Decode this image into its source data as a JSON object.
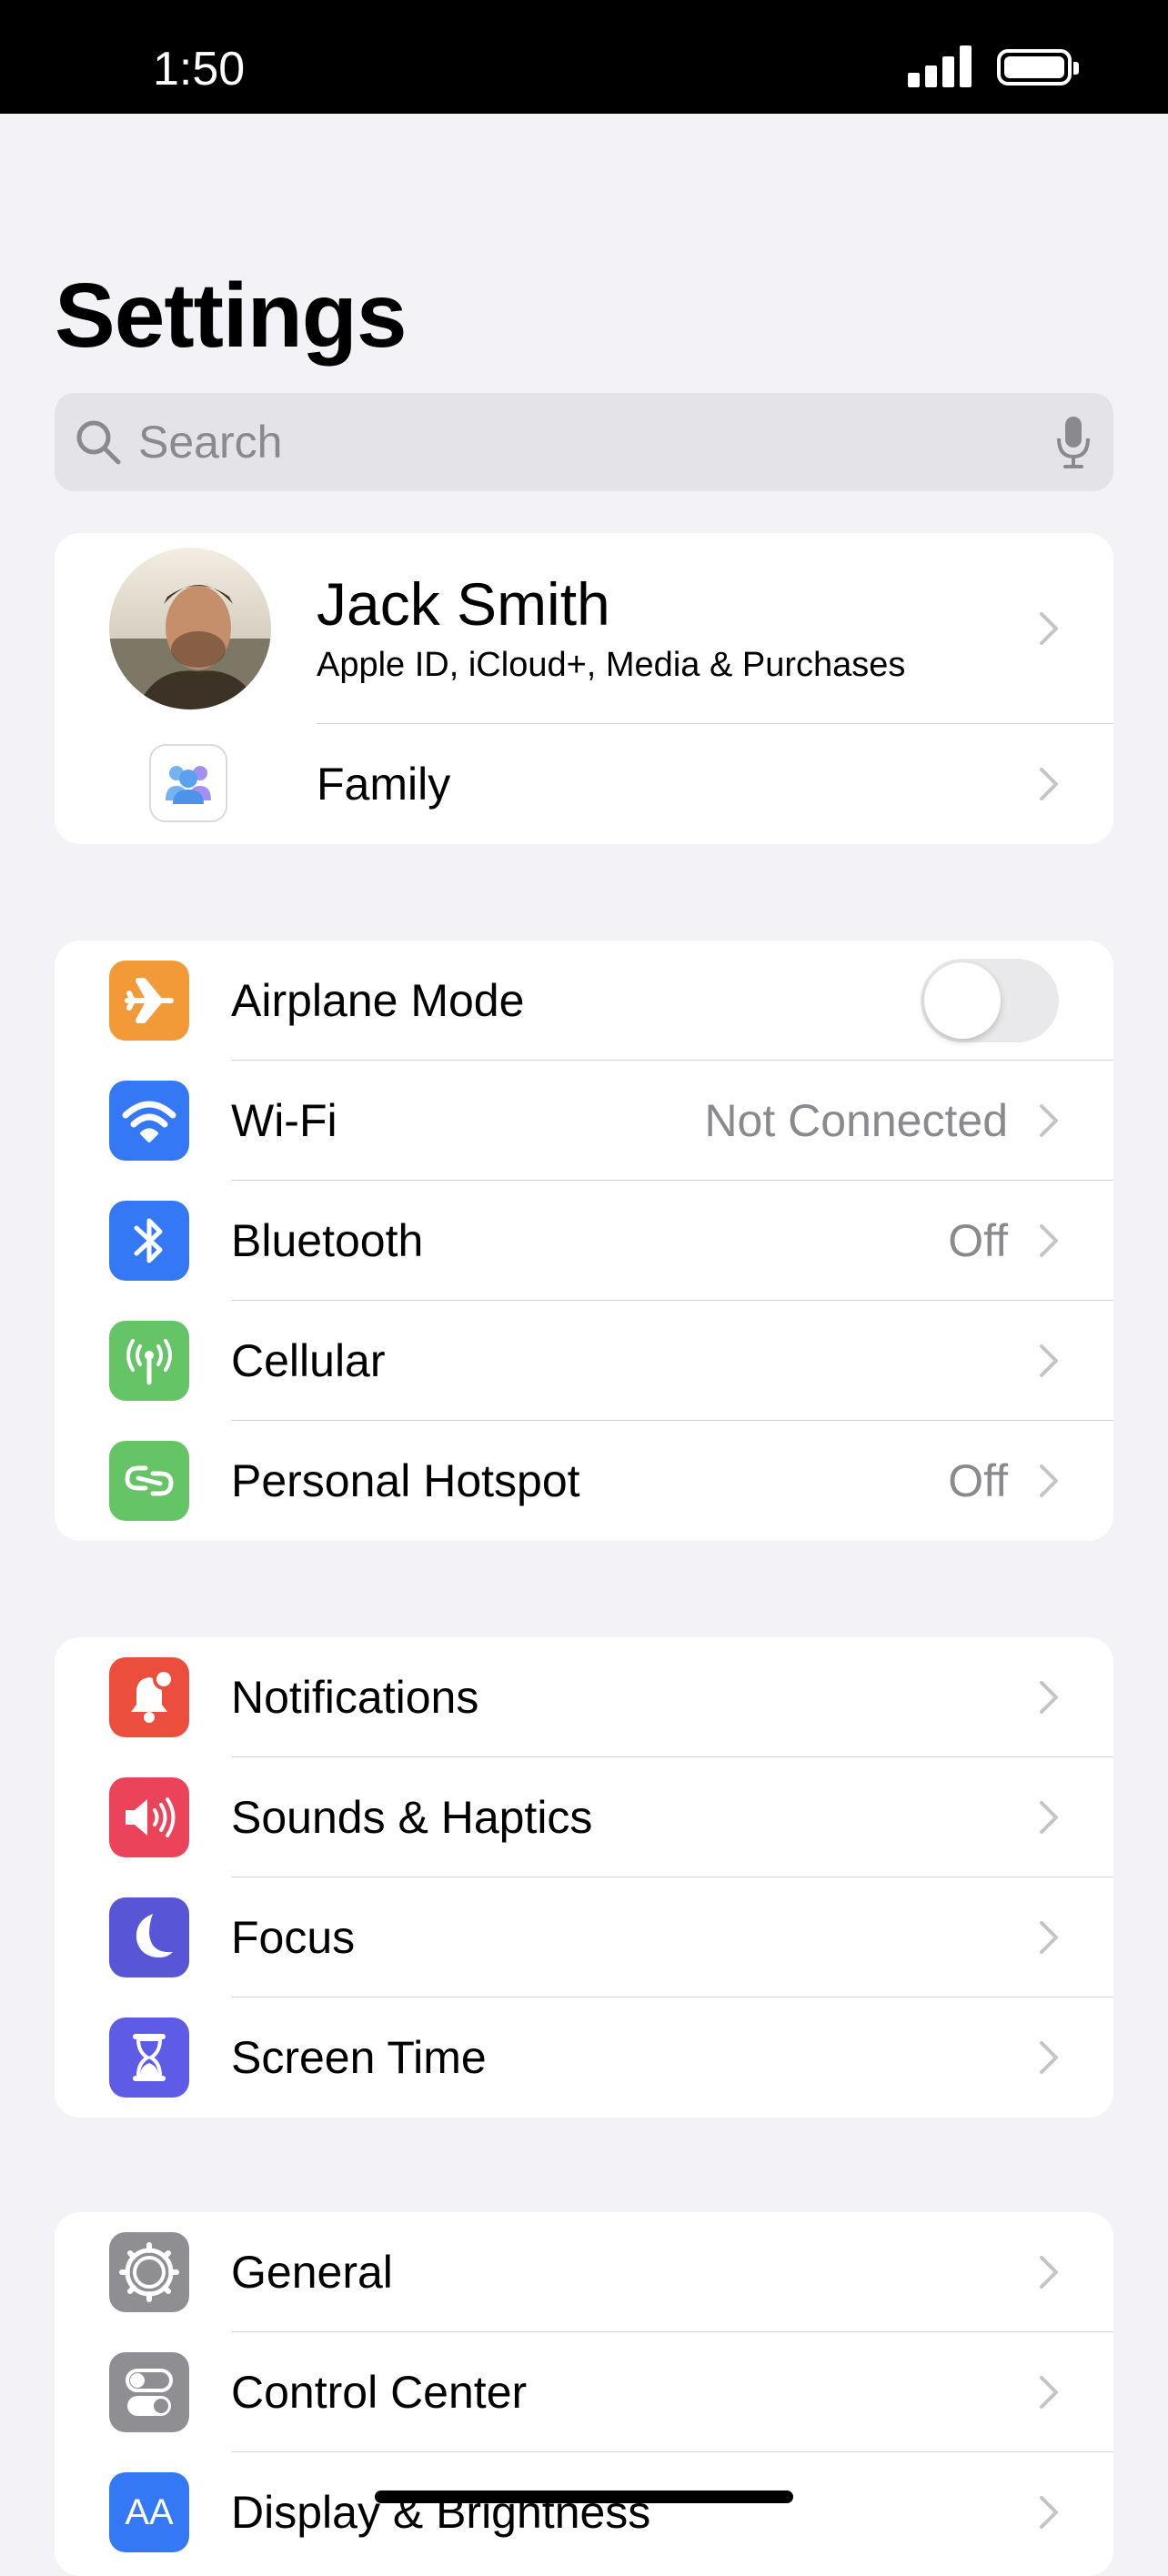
{
  "status_bar": {
    "time": "1:50"
  },
  "header": {
    "title": "Settings"
  },
  "search": {
    "placeholder": "Search"
  },
  "account": {
    "name": "Jack Smith",
    "subtitle": "Apple ID, iCloud+, Media & Purchases",
    "family_label": "Family"
  },
  "connectivity": {
    "airplane_label": "Airplane Mode",
    "airplane_on": false,
    "wifi_label": "Wi-Fi",
    "wifi_value": "Not Connected",
    "bluetooth_label": "Bluetooth",
    "bluetooth_value": "Off",
    "cellular_label": "Cellular",
    "hotspot_label": "Personal Hotspot",
    "hotspot_value": "Off"
  },
  "attention": {
    "notifications_label": "Notifications",
    "sounds_label": "Sounds & Haptics",
    "focus_label": "Focus",
    "screen_time_label": "Screen Time"
  },
  "system": {
    "general_label": "General",
    "control_center_label": "Control Center",
    "display_label": "Display & Brightness",
    "display_icon_text": "AA"
  },
  "colors": {
    "airplane": "#f19a37",
    "wifi": "#3478f6",
    "bluetooth": "#3478f6",
    "cellular": "#65c466",
    "hotspot": "#65c466",
    "notifications": "#eb4e3d",
    "sounds": "#eb445a",
    "focus": "#5856d6",
    "screen_time": "#5e5ce6",
    "general": "#8e8e93",
    "control_center": "#8e8e93",
    "display": "#3478f6"
  },
  "icons": [
    "search-icon",
    "mic-icon",
    "family-icon",
    "airplane-icon",
    "wifi-icon",
    "bluetooth-icon",
    "cellular-icon",
    "hotspot-icon",
    "bell-icon",
    "speaker-icon",
    "moon-icon",
    "hourglass-icon",
    "gear-icon",
    "switches-icon",
    "text-size-icon",
    "chevron-right-icon"
  ]
}
